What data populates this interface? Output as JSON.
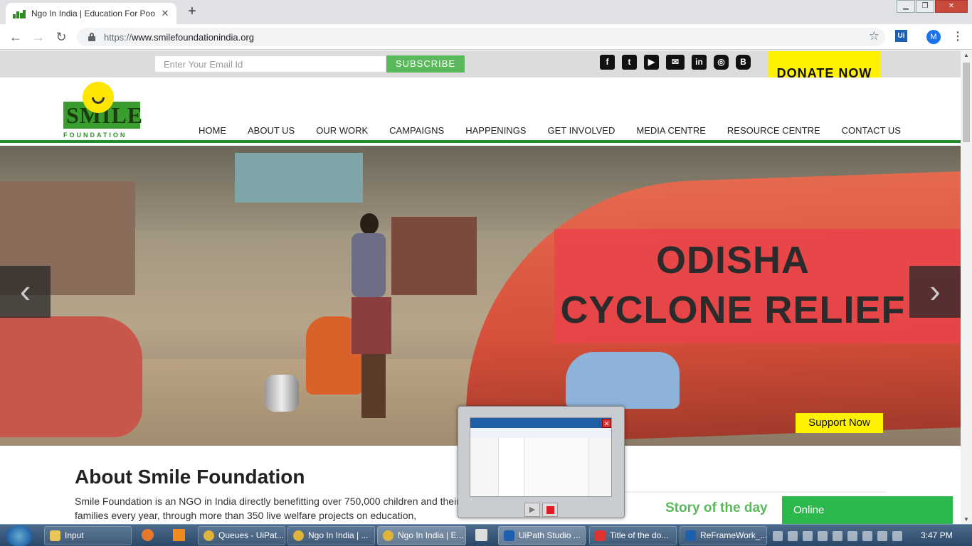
{
  "browser": {
    "tab_title": "Ngo In India | Education For Poor",
    "url_scheme": "https://",
    "url_host": "www.smilefoundationindia.org",
    "new_tab": "+",
    "avatar_initial": "M",
    "ext_label": "Ui"
  },
  "topbar": {
    "email_placeholder": "Enter Your Email Id",
    "subscribe": "SUBSCRIBE",
    "donate": "DONATE NOW",
    "social": [
      "facebook-icon",
      "twitter-icon",
      "youtube-icon",
      "mail-icon",
      "linkedin-icon",
      "instagram-icon",
      "blogger-icon"
    ]
  },
  "logo": {
    "word": "SMILE",
    "sub": "FOUNDATION"
  },
  "nav": [
    "HOME",
    "ABOUT US",
    "OUR WORK",
    "CAMPAIGNS",
    "HAPPENINGS",
    "GET INVOLVED",
    "MEDIA CENTRE",
    "RESOURCE CENTRE",
    "CONTACT US"
  ],
  "hero": {
    "line1": "ODISHA",
    "line2": "CYCLONE RELIEF",
    "support": "Support Now"
  },
  "about": {
    "title": "About Smile Foundation",
    "text": "Smile Foundation is an NGO in India directly benefitting over 750,000 children and their families every year, through more than 350 live welfare projects on education,"
  },
  "story": {
    "title": "Story of the day"
  },
  "chat": {
    "status": "Online"
  },
  "taskbar": {
    "items": [
      "Input",
      "Queues - UiPat...",
      "Ngo In India | ...",
      "Ngo In India | E...",
      "UiPath Studio ...",
      "Title of the do...",
      "ReFrameWork_..."
    ],
    "clock": "3:47 PM"
  },
  "colors": {
    "green": "#1f8f2a",
    "subscribe_green": "#5cb85c",
    "donate_yellow": "#fff200",
    "banner_red": "#e8444a"
  }
}
